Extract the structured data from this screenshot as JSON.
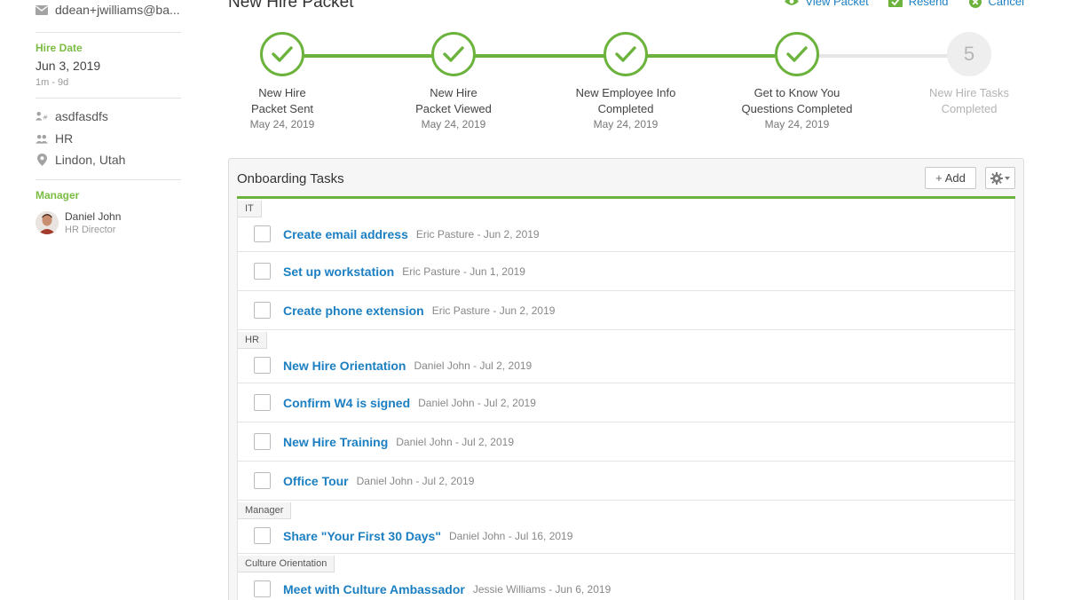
{
  "sidebar": {
    "email": "ddean+jwilliams@ba...",
    "hire_date_label": "Hire Date",
    "hire_date": "Jun 3, 2019",
    "hire_relative": "1m - 9d",
    "employee_id": "asdfasdfs",
    "department": "HR",
    "location": "Lindon, Utah",
    "manager_label": "Manager",
    "manager_name": "Daniel John",
    "manager_title": "HR Director"
  },
  "header": {
    "title": "New Hire Packet",
    "actions": [
      {
        "label": "View Packet",
        "icon": "eye-icon"
      },
      {
        "label": "Resend",
        "icon": "mail-check-icon"
      },
      {
        "label": "Cancel",
        "icon": "x-circle-icon"
      }
    ]
  },
  "steps": [
    {
      "line1": "New Hire",
      "line2": "Packet Sent",
      "date": "May 24, 2019",
      "done": true
    },
    {
      "line1": "New Hire",
      "line2": "Packet Viewed",
      "date": "May 24, 2019",
      "done": true
    },
    {
      "line1": "New Employee Info",
      "line2": "Completed",
      "date": "May 24, 2019",
      "done": true
    },
    {
      "line1": "Get to Know You",
      "line2": "Questions Completed",
      "date": "May 24, 2019",
      "done": true
    },
    {
      "line1": "New Hire Tasks",
      "line2": "Completed",
      "date": "",
      "done": false,
      "number": "5"
    }
  ],
  "tasks_panel": {
    "title": "Onboarding Tasks",
    "add_label": "Add",
    "categories": [
      {
        "name": "IT",
        "tasks": [
          {
            "title": "Create email address",
            "meta": "Eric Pasture - Jun 2, 2019"
          },
          {
            "title": "Set up workstation",
            "meta": "Eric Pasture - Jun 1, 2019"
          },
          {
            "title": "Create phone extension",
            "meta": "Eric Pasture - Jun 2, 2019"
          }
        ]
      },
      {
        "name": "HR",
        "tasks": [
          {
            "title": "New Hire Orientation",
            "meta": "Daniel John - Jul 2, 2019"
          },
          {
            "title": "Confirm W4 is signed",
            "meta": "Daniel John - Jul 2, 2019"
          },
          {
            "title": "New Hire Training",
            "meta": "Daniel John - Jul 2, 2019"
          },
          {
            "title": "Office Tour",
            "meta": "Daniel John - Jul 2, 2019"
          }
        ]
      },
      {
        "name": "Manager",
        "tasks": [
          {
            "title": "Share \"Your First 30 Days\"",
            "meta": "Daniel John - Jul 16, 2019"
          }
        ]
      },
      {
        "name": "Culture Orientation",
        "tasks": [
          {
            "title": "Meet with Culture Ambassador",
            "meta": "Jessie Williams - Jun 6, 2019"
          }
        ]
      }
    ]
  },
  "colors": {
    "accent_green": "#6cb33e",
    "link_blue": "#1b7fc2",
    "label_green": "#7bbd42"
  }
}
